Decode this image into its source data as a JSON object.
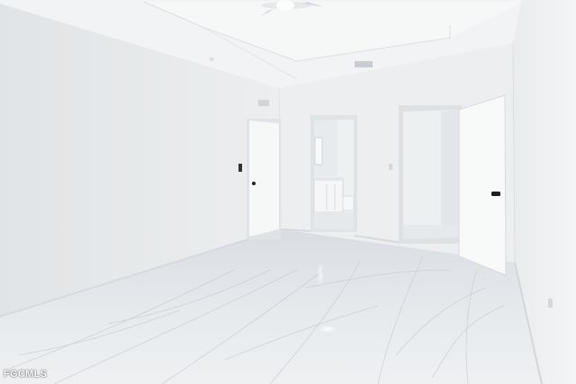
{
  "watermark": {
    "text": "FGCMLS"
  },
  "colors": {
    "wall_left": "#e6e9ea",
    "wall_back": "#eef0f1",
    "wall_right": "#f0f2f3",
    "ceiling": "#f3f4f5",
    "floor": "#e4e7ea",
    "door": "#f7f8f8",
    "door_frame": "#dfe3e5",
    "marble_vein": "#c9cdd2"
  },
  "icons": [
    "ceiling-fan-icon",
    "air-vent-icon",
    "door-handle-icon",
    "light-switch-icon"
  ]
}
